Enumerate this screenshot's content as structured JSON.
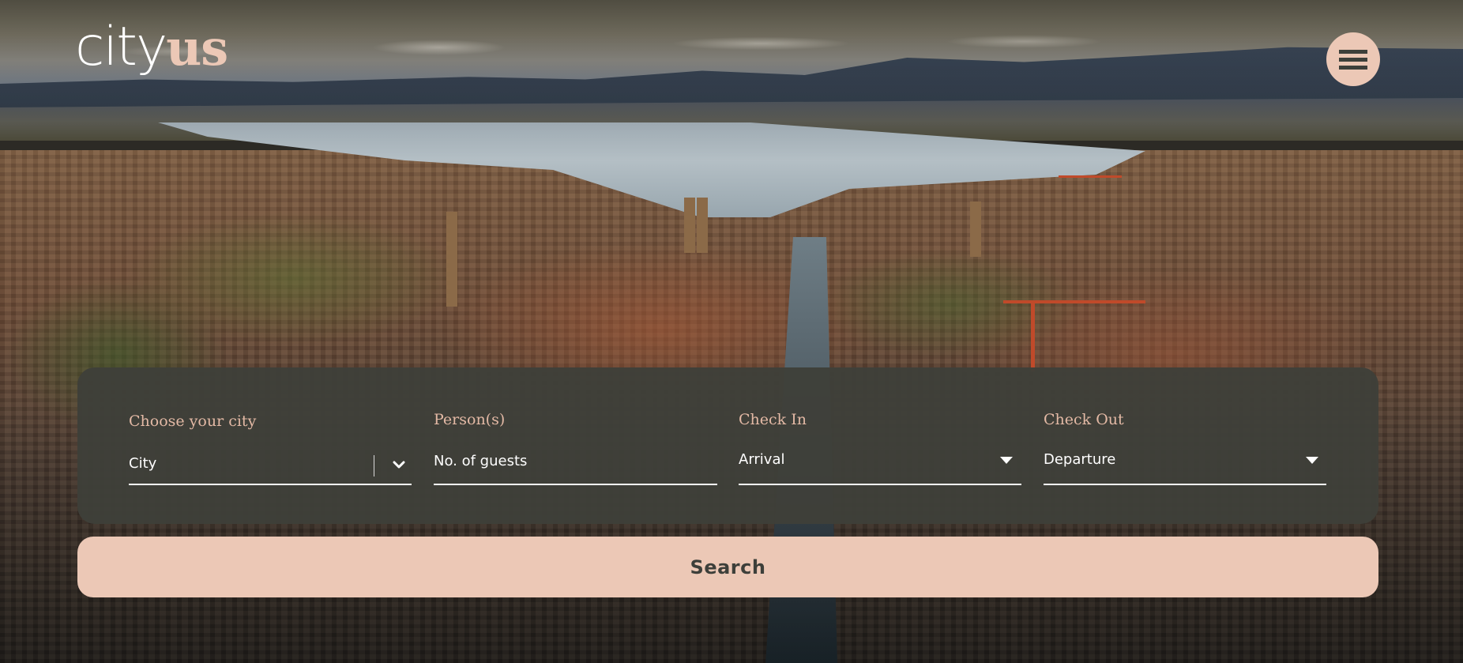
{
  "brand": {
    "logo_part1": "city",
    "logo_part2": "us",
    "accent_color": "#ecc8b6",
    "dark_color": "#3d3f3a"
  },
  "header": {
    "menu_icon": "hamburger-menu-icon"
  },
  "background": {
    "description": "Aerial view of a lakeside city with church towers, river and mountains at sunset"
  },
  "search_form": {
    "fields": [
      {
        "label": "Choose your city",
        "value": "City",
        "type": "select",
        "icon": "chevron-down-icon"
      },
      {
        "label": "Person(s)",
        "placeholder": "No. of guests",
        "type": "input"
      },
      {
        "label": "Check In",
        "value": "Arrival",
        "type": "select",
        "icon": "caret-down-icon"
      },
      {
        "label": "Check Out",
        "value": "Departure",
        "type": "select",
        "icon": "caret-down-icon"
      }
    ],
    "submit_label": "Search"
  }
}
